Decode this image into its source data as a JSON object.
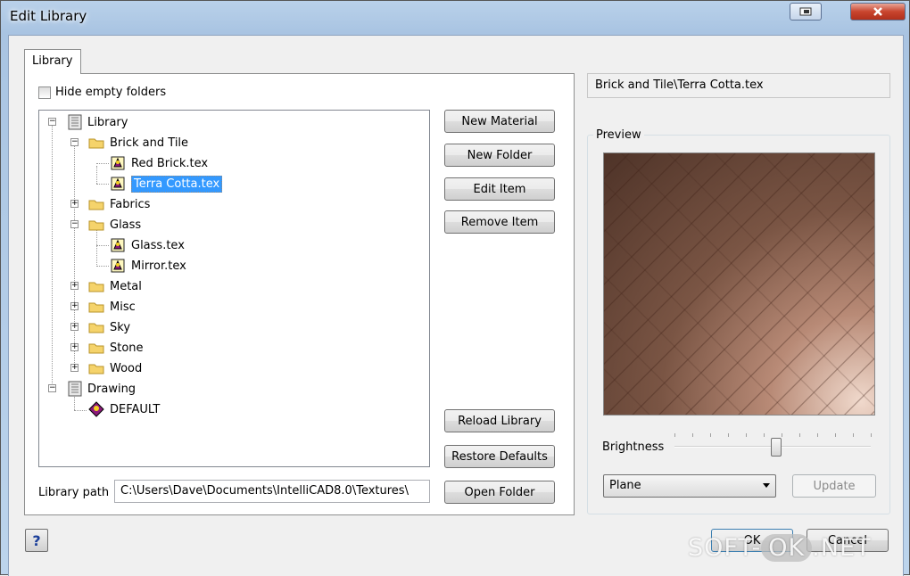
{
  "window": {
    "title": "Edit Library"
  },
  "tabs": [
    {
      "label": "Library"
    }
  ],
  "hide_empty": {
    "label": "Hide empty folders",
    "checked": false
  },
  "tree": {
    "library_root": "Library",
    "brick_folder": "Brick and Tile",
    "red_brick": "Red Brick.tex",
    "terra_cotta": "Terra Cotta.tex",
    "fabrics": "Fabrics",
    "glass_folder": "Glass",
    "glass_file": "Glass.tex",
    "mirror_file": "Mirror.tex",
    "metal": "Metal",
    "misc": "Misc",
    "sky": "Sky",
    "stone": "Stone",
    "wood": "Wood",
    "drawing_root": "Drawing",
    "default_item": "DEFAULT",
    "selected": "Terra Cotta.tex"
  },
  "buttons": {
    "new_material": "New Material",
    "new_folder": "New Folder",
    "edit_item": "Edit Item",
    "remove_item": "Remove Item",
    "reload_library": "Reload Library",
    "restore_defaults": "Restore Defaults",
    "open_folder": "Open Folder",
    "update": "Update",
    "ok": "OK",
    "cancel": "Cancel",
    "help": "?"
  },
  "library_path": {
    "label": "Library path",
    "value": "C:\\Users\\Dave\\Documents\\IntelliCAD8.0\\Textures\\"
  },
  "material_name": "Brick and Tile\\Terra Cotta.tex",
  "preview": {
    "label": "Preview"
  },
  "brightness": {
    "label": "Brightness",
    "value_fraction": 0.52
  },
  "shape_select": {
    "value": "Plane"
  },
  "watermark": {
    "prefix": "SOFT-",
    "ok": "OK",
    "suffix": ".NET"
  },
  "colors": {
    "selection": "#3399ff",
    "close_button": "#c9452e",
    "folder": "#f5d36b"
  }
}
